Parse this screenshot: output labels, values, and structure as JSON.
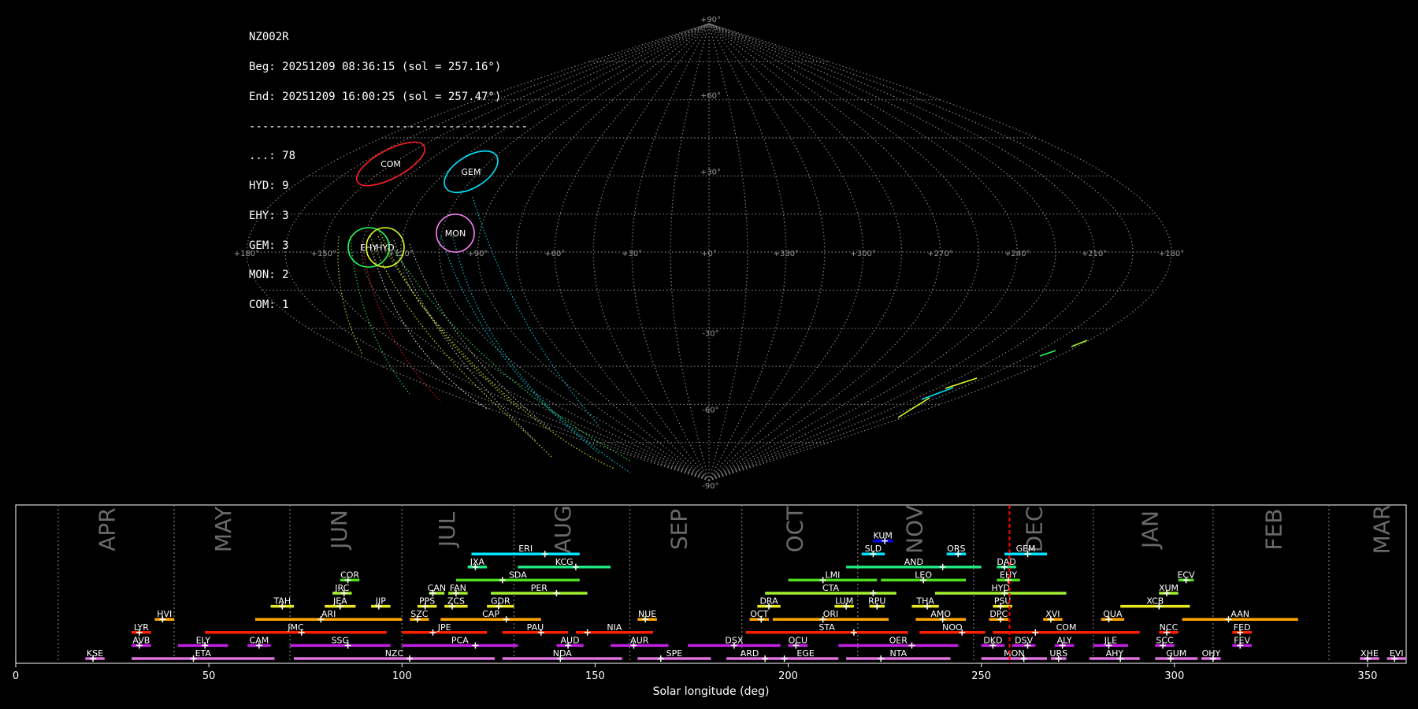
{
  "info": {
    "station": "NZ002R",
    "beg": "Beg: 20251209 08:36:15 (sol = 257.16°)",
    "end": "End: 20251209 16:00:25 (sol = 257.47°)",
    "rule": "------------------------------------------",
    "counts": [
      "...: 78",
      "HYD: 9",
      "EHY: 3",
      "GEM: 3",
      "MON: 2",
      "COM: 1"
    ]
  },
  "colors": {
    "background": "#000000",
    "grid": "#7f7f7f",
    "current_sol": "#ff0000",
    "frame": "#ffffff"
  },
  "sky": {
    "lon_labels": [
      "+180°",
      "+150°",
      "+120°",
      "+90°",
      "+60°",
      "+30°",
      "+0°",
      "+330°",
      "+300°",
      "+270°",
      "+240°",
      "+210°",
      "+180°"
    ],
    "lat_labels": [
      "+90°",
      "+60°",
      "+30°",
      "-30°",
      "-60°",
      "-90°"
    ],
    "radiants": [
      {
        "code": "COM",
        "color": "#ff2020"
      },
      {
        "code": "GEM",
        "color": "#00e5ff"
      },
      {
        "code": "MON",
        "color": "#ff80ff"
      },
      {
        "code": "EHY",
        "color": "#20ff60"
      },
      {
        "code": "HYD",
        "color": "#e0ff20"
      }
    ]
  },
  "chart_data": {
    "type": "timeline",
    "xlabel": "Solar longitude (deg)",
    "xlim": [
      0,
      360
    ],
    "xticks": [
      0,
      50,
      100,
      150,
      200,
      250,
      300,
      350
    ],
    "current_sol": 257.3,
    "months": [
      {
        "name": "APR",
        "sol": 24
      },
      {
        "name": "MAY",
        "sol": 54
      },
      {
        "name": "JUN",
        "sol": 84
      },
      {
        "name": "JUL",
        "sol": 112
      },
      {
        "name": "AUG",
        "sol": 142
      },
      {
        "name": "SEP",
        "sol": 172
      },
      {
        "name": "OCT",
        "sol": 202
      },
      {
        "name": "NOV",
        "sol": 233
      },
      {
        "name": "DEC",
        "sol": 264
      },
      {
        "name": "JAN",
        "sol": 294
      },
      {
        "name": "FEB",
        "sol": 326
      },
      {
        "name": "MAR",
        "sol": 354
      }
    ],
    "month_boundaries": [
      11,
      41,
      71,
      100,
      129,
      159,
      188,
      218,
      248,
      279,
      310,
      340
    ],
    "showers": [
      {
        "code": "KUM",
        "start": 222,
        "end": 227,
        "peak": 225,
        "row": 10,
        "color": "#0000ff"
      },
      {
        "code": "ERI",
        "start": 118,
        "end": 146,
        "peak": 137,
        "row": 9,
        "color": "#00e5ff"
      },
      {
        "code": "SLD",
        "start": 219,
        "end": 225,
        "peak": 222,
        "row": 9,
        "color": "#00e5ff"
      },
      {
        "code": "ORS",
        "start": 241,
        "end": 246,
        "peak": 244,
        "row": 9,
        "color": "#00e5ff"
      },
      {
        "code": "GEM",
        "start": 256,
        "end": 267,
        "peak": 262,
        "row": 9,
        "color": "#00e5ff"
      },
      {
        "code": "JXA",
        "start": 117,
        "end": 122,
        "peak": 119,
        "row": 8,
        "color": "#20e880"
      },
      {
        "code": "KCG",
        "start": 130,
        "end": 154,
        "peak": 145,
        "row": 8,
        "color": "#20e880"
      },
      {
        "code": "AND",
        "start": 215,
        "end": 250,
        "peak": 240,
        "row": 8,
        "color": "#20e880"
      },
      {
        "code": "DAD",
        "start": 254,
        "end": 259,
        "peak": 256,
        "row": 8,
        "color": "#20e880"
      },
      {
        "code": "COR",
        "start": 84,
        "end": 89,
        "peak": 86,
        "row": 7,
        "color": "#50dd20"
      },
      {
        "code": "SDA",
        "start": 114,
        "end": 146,
        "peak": 126,
        "row": 7,
        "color": "#50dd20"
      },
      {
        "code": "LMI",
        "start": 200,
        "end": 223,
        "peak": 209,
        "row": 7,
        "color": "#50dd20"
      },
      {
        "code": "LEO",
        "start": 224,
        "end": 246,
        "peak": 235,
        "row": 7,
        "color": "#50dd20"
      },
      {
        "code": "EHY",
        "start": 254,
        "end": 260,
        "peak": 257,
        "row": 7,
        "color": "#50dd20"
      },
      {
        "code": "ECV",
        "start": 301,
        "end": 305,
        "peak": 303,
        "row": 7,
        "color": "#50dd20"
      },
      {
        "code": "JRC",
        "start": 82,
        "end": 87,
        "peak": 85,
        "row": 6,
        "color": "#a0f030"
      },
      {
        "code": "CAN",
        "start": 107,
        "end": 111,
        "peak": 108,
        "row": 6,
        "color": "#a0f030"
      },
      {
        "code": "FAN",
        "start": 112,
        "end": 117,
        "peak": 114,
        "row": 6,
        "color": "#a0f030"
      },
      {
        "code": "PER",
        "start": 123,
        "end": 148,
        "peak": 140,
        "row": 6,
        "color": "#a0f030"
      },
      {
        "code": "CTA",
        "start": 194,
        "end": 228,
        "peak": 222,
        "row": 6,
        "color": "#a0f030"
      },
      {
        "code": "HYD",
        "start": 238,
        "end": 272,
        "peak": 256,
        "row": 6,
        "color": "#a0f030"
      },
      {
        "code": "XUM",
        "start": 296,
        "end": 301,
        "peak": 298,
        "row": 6,
        "color": "#a0f030"
      },
      {
        "code": "TAH",
        "start": 66,
        "end": 72,
        "peak": 69,
        "row": 5,
        "color": "#e8e820"
      },
      {
        "code": "JEA",
        "start": 80,
        "end": 88,
        "peak": 84,
        "row": 5,
        "color": "#e8e820"
      },
      {
        "code": "JIP",
        "start": 92,
        "end": 97,
        "peak": 94,
        "row": 5,
        "color": "#e8e820"
      },
      {
        "code": "PPS",
        "start": 104,
        "end": 109,
        "peak": 106,
        "row": 5,
        "color": "#e8e820"
      },
      {
        "code": "ZCS",
        "start": 111,
        "end": 117,
        "peak": 113,
        "row": 5,
        "color": "#e8e820"
      },
      {
        "code": "GDR",
        "start": 122,
        "end": 129,
        "peak": 125,
        "row": 5,
        "color": "#e8e820"
      },
      {
        "code": "DRA",
        "start": 192,
        "end": 198,
        "peak": 195,
        "row": 5,
        "color": "#e8e820"
      },
      {
        "code": "LUM",
        "start": 212,
        "end": 217,
        "peak": 215,
        "row": 5,
        "color": "#e8e820"
      },
      {
        "code": "RPU",
        "start": 221,
        "end": 225,
        "peak": 223,
        "row": 5,
        "color": "#e8e820"
      },
      {
        "code": "THA",
        "start": 232,
        "end": 239,
        "peak": 236,
        "row": 5,
        "color": "#e8e820"
      },
      {
        "code": "PSU",
        "start": 253,
        "end": 258,
        "peak": 255,
        "row": 5,
        "color": "#e8e820"
      },
      {
        "code": "XCB",
        "start": 286,
        "end": 304,
        "peak": 296,
        "row": 5,
        "color": "#e8e820"
      },
      {
        "code": "HVI",
        "start": 36,
        "end": 41,
        "peak": 38,
        "row": 4,
        "color": "#ffa500"
      },
      {
        "code": "ARI",
        "start": 62,
        "end": 100,
        "peak": 79,
        "row": 4,
        "color": "#ffa500"
      },
      {
        "code": "SZC",
        "start": 102,
        "end": 107,
        "peak": 104,
        "row": 4,
        "color": "#ffa500"
      },
      {
        "code": "CAP",
        "start": 110,
        "end": 136,
        "peak": 127,
        "row": 4,
        "color": "#ffa500"
      },
      {
        "code": "NUE",
        "start": 161,
        "end": 166,
        "peak": 163,
        "row": 4,
        "color": "#ffa500"
      },
      {
        "code": "OCT",
        "start": 190,
        "end": 195,
        "peak": 193,
        "row": 4,
        "color": "#ffa500"
      },
      {
        "code": "ORI",
        "start": 196,
        "end": 226,
        "peak": 209,
        "row": 4,
        "color": "#ffa500"
      },
      {
        "code": "AMO",
        "start": 233,
        "end": 246,
        "peak": 240,
        "row": 4,
        "color": "#ffa500"
      },
      {
        "code": "DPC",
        "start": 252,
        "end": 257,
        "peak": 255,
        "row": 4,
        "color": "#ffa500"
      },
      {
        "code": "XVI",
        "start": 266,
        "end": 271,
        "peak": 268,
        "row": 4,
        "color": "#ffa500"
      },
      {
        "code": "QUA",
        "start": 281,
        "end": 287,
        "peak": 283,
        "row": 4,
        "color": "#ffa500"
      },
      {
        "code": "AAN",
        "start": 302,
        "end": 332,
        "peak": 314,
        "row": 4,
        "color": "#ffa500"
      },
      {
        "code": "LYR",
        "start": 30,
        "end": 35,
        "peak": 32,
        "row": 3,
        "color": "#ff2000"
      },
      {
        "code": "JMC",
        "start": 49,
        "end": 96,
        "peak": 74,
        "row": 3,
        "color": "#ff2000"
      },
      {
        "code": "JPE",
        "start": 100,
        "end": 122,
        "peak": 108,
        "row": 3,
        "color": "#ff2000"
      },
      {
        "code": "PAU",
        "start": 126,
        "end": 143,
        "peak": 136,
        "row": 3,
        "color": "#ff2000"
      },
      {
        "code": "NIA",
        "start": 145,
        "end": 165,
        "peak": 148,
        "row": 3,
        "color": "#ff2000"
      },
      {
        "code": "STA",
        "start": 189,
        "end": 231,
        "peak": 217,
        "row": 3,
        "color": "#ff2000"
      },
      {
        "code": "NOO",
        "start": 234,
        "end": 251,
        "peak": 245,
        "row": 3,
        "color": "#ff2000"
      },
      {
        "code": "COM",
        "start": 253,
        "end": 291,
        "peak": 264,
        "row": 3,
        "color": "#ff2000"
      },
      {
        "code": "NCC",
        "start": 296,
        "end": 301,
        "peak": 298,
        "row": 3,
        "color": "#ff2000"
      },
      {
        "code": "FED",
        "start": 315,
        "end": 320,
        "peak": 317,
        "row": 3,
        "color": "#ff2000"
      },
      {
        "code": "AVB",
        "start": 30,
        "end": 35,
        "peak": 32,
        "row": 2,
        "color": "#c020e0"
      },
      {
        "code": "ELY",
        "start": 42,
        "end": 55,
        "peak": 49,
        "row": 2,
        "color": "#c020e0"
      },
      {
        "code": "CAM",
        "start": 60,
        "end": 66,
        "peak": 63,
        "row": 2,
        "color": "#c020e0"
      },
      {
        "code": "SSG",
        "start": 71,
        "end": 97,
        "peak": 86,
        "row": 2,
        "color": "#c020e0"
      },
      {
        "code": "PCA",
        "start": 100,
        "end": 130,
        "peak": 119,
        "row": 2,
        "color": "#c020e0"
      },
      {
        "code": "AUD",
        "start": 140,
        "end": 147,
        "peak": 143,
        "row": 2,
        "color": "#c020e0"
      },
      {
        "code": "AUR",
        "start": 154,
        "end": 169,
        "peak": 160,
        "row": 2,
        "color": "#c020e0"
      },
      {
        "code": "DSX",
        "start": 174,
        "end": 198,
        "peak": 186,
        "row": 2,
        "color": "#c020e0"
      },
      {
        "code": "OCU",
        "start": 200,
        "end": 205,
        "peak": 202,
        "row": 2,
        "color": "#c020e0"
      },
      {
        "code": "OER",
        "start": 213,
        "end": 244,
        "peak": 232,
        "row": 2,
        "color": "#c020e0"
      },
      {
        "code": "DKD",
        "start": 250,
        "end": 256,
        "peak": 253,
        "row": 2,
        "color": "#c020e0"
      },
      {
        "code": "DSV",
        "start": 258,
        "end": 264,
        "peak": 262,
        "row": 2,
        "color": "#c020e0"
      },
      {
        "code": "ALY",
        "start": 269,
        "end": 274,
        "peak": 271,
        "row": 2,
        "color": "#c020e0"
      },
      {
        "code": "JLE",
        "start": 279,
        "end": 288,
        "peak": 283,
        "row": 2,
        "color": "#c020e0"
      },
      {
        "code": "SCC",
        "start": 295,
        "end": 300,
        "peak": 297,
        "row": 2,
        "color": "#c020e0"
      },
      {
        "code": "FEV",
        "start": 315,
        "end": 320,
        "peak": 317,
        "row": 2,
        "color": "#c020e0"
      },
      {
        "code": "KSE",
        "start": 18,
        "end": 23,
        "peak": 20,
        "row": 1,
        "color": "#e070e0"
      },
      {
        "code": "ETA",
        "start": 30,
        "end": 67,
        "peak": 46,
        "row": 1,
        "color": "#e070e0"
      },
      {
        "code": "NZC",
        "start": 72,
        "end": 124,
        "peak": 102,
        "row": 1,
        "color": "#e070e0"
      },
      {
        "code": "NDA",
        "start": 126,
        "end": 157,
        "peak": 141,
        "row": 1,
        "color": "#e070e0"
      },
      {
        "code": "SPE",
        "start": 161,
        "end": 180,
        "peak": 167,
        "row": 1,
        "color": "#e070e0"
      },
      {
        "code": "ARD",
        "start": 184,
        "end": 196,
        "peak": 194,
        "row": 1,
        "color": "#e070e0"
      },
      {
        "code": "EGE",
        "start": 196,
        "end": 213,
        "peak": 199,
        "row": 1,
        "color": "#e070e0"
      },
      {
        "code": "NTA",
        "start": 215,
        "end": 242,
        "peak": 224,
        "row": 1,
        "color": "#e070e0"
      },
      {
        "code": "MON",
        "start": 250,
        "end": 267,
        "peak": 261,
        "row": 1,
        "color": "#e070e0"
      },
      {
        "code": "URS",
        "start": 268,
        "end": 272,
        "peak": 270,
        "row": 1,
        "color": "#e070e0"
      },
      {
        "code": "AHY",
        "start": 278,
        "end": 291,
        "peak": 286,
        "row": 1,
        "color": "#e070e0"
      },
      {
        "code": "GUM",
        "start": 295,
        "end": 306,
        "peak": 299,
        "row": 1,
        "color": "#e070e0"
      },
      {
        "code": "OHY",
        "start": 307,
        "end": 312,
        "peak": 310,
        "row": 1,
        "color": "#e070e0"
      },
      {
        "code": "XHE",
        "start": 348,
        "end": 353,
        "peak": 350,
        "row": 1,
        "color": "#e070e0"
      },
      {
        "code": "EVI",
        "start": 355,
        "end": 360,
        "peak": 357,
        "row": 1,
        "color": "#e070e0"
      }
    ]
  }
}
